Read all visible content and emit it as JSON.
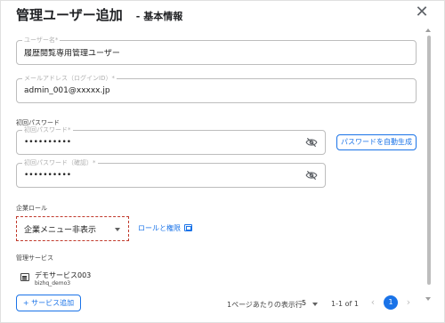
{
  "dialog": {
    "title": "管理ユーザー追加",
    "subtitle": "- 基本情報",
    "close_icon": "close-icon"
  },
  "fields": {
    "username": {
      "label": "ユーザー名*",
      "value": "履歴閲覧専用管理ユーザー"
    },
    "email": {
      "label": "メールアドレス（ログインID）*",
      "value": "admin_001@xxxxx.jp"
    },
    "password_section_label": "初回パスワード",
    "password": {
      "label": "初回パスワード*",
      "value": "••••••••••"
    },
    "password_confirm": {
      "label": "初回パスワード（確認）*",
      "value": "••••••••••"
    },
    "generate_password_button": "パスワードを自動生成"
  },
  "role": {
    "section_label": "企業ロール",
    "selected": "企業メニュー非表示",
    "link_label": "ロールと権限"
  },
  "services": {
    "section_label": "管理サービス",
    "items": [
      {
        "name": "デモサービス003",
        "id": "bizhq_demo3"
      }
    ],
    "add_button": "+ サービス追加"
  },
  "pagination": {
    "per_page_label": "1ページあたりの表示行",
    "per_page_value": "5",
    "range": "1-1 of 1",
    "current_page": "1",
    "prev_label": "‹",
    "next_label": "›"
  },
  "colors": {
    "accent": "#1a73e8",
    "focus_outline": "#c0392b"
  }
}
